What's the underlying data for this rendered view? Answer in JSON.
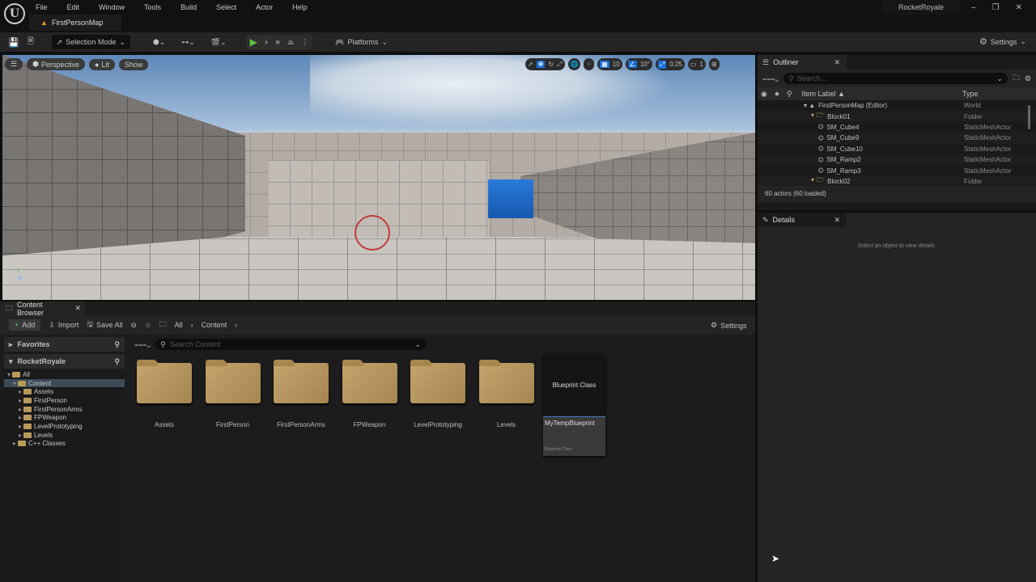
{
  "menu": [
    "File",
    "Edit",
    "Window",
    "Tools",
    "Build",
    "Select",
    "Actor",
    "Help"
  ],
  "tab": "FirstPersonMap",
  "project": "RocketRoyale",
  "toolbar": {
    "selection_mode": "Selection Mode",
    "platforms": "Platforms",
    "settings": "Settings"
  },
  "viewport": {
    "perspective": "Perspective",
    "lit": "Lit",
    "show": "Show",
    "grid": "10",
    "rotation": "10°",
    "scale": "0.25",
    "camera": "1"
  },
  "outliner": {
    "title": "Outliner",
    "search_placeholder": "Search...",
    "col_label": "Item Label ▲",
    "col_type": "Type",
    "rows": [
      {
        "label": "FirstPersonMap (Editor)",
        "type": "World",
        "indent": 0,
        "kind": "world"
      },
      {
        "label": "Block01",
        "type": "Folder",
        "indent": 1,
        "kind": "folder"
      },
      {
        "label": "SM_Cube4",
        "type": "StaticMeshActor",
        "indent": 2,
        "kind": "mesh"
      },
      {
        "label": "SM_Cube9",
        "type": "StaticMeshActor",
        "indent": 2,
        "kind": "mesh"
      },
      {
        "label": "SM_Cube10",
        "type": "StaticMeshActor",
        "indent": 2,
        "kind": "mesh"
      },
      {
        "label": "SM_Ramp2",
        "type": "StaticMeshActor",
        "indent": 2,
        "kind": "mesh"
      },
      {
        "label": "SM_Ramp3",
        "type": "StaticMeshActor",
        "indent": 2,
        "kind": "mesh"
      },
      {
        "label": "Block02",
        "type": "Folder",
        "indent": 1,
        "kind": "folder"
      }
    ],
    "status": "60 actors (60 loaded)"
  },
  "details": {
    "title": "Details",
    "empty": "Select an object to view details."
  },
  "content_browser": {
    "title": "Content Browser",
    "add": "Add",
    "import": "Import",
    "save_all": "Save All",
    "crumbs": [
      "All",
      "Content"
    ],
    "settings": "Settings",
    "search_placeholder": "Search Content",
    "favorites": "Favorites",
    "project": "RocketRoyale",
    "tree": [
      {
        "label": "All",
        "indent": 0
      },
      {
        "label": "Content",
        "indent": 1
      },
      {
        "label": "Assets",
        "indent": 2
      },
      {
        "label": "FirstPerson",
        "indent": 2
      },
      {
        "label": "FirstPersonArms",
        "indent": 2
      },
      {
        "label": "FPWeapon",
        "indent": 2
      },
      {
        "label": "LevelPrototyping",
        "indent": 2
      },
      {
        "label": "Levels",
        "indent": 2
      },
      {
        "label": "C++ Classes",
        "indent": 1
      }
    ],
    "folders": [
      "Assets",
      "FirstPerson",
      "FirstPersonArms",
      "FPWeapon",
      "LevelPrototyping",
      "Levels"
    ],
    "blueprint": {
      "thumb": "Blueprint Class",
      "name": "MyTempBlueprint",
      "type": "Blueprint Class"
    }
  }
}
